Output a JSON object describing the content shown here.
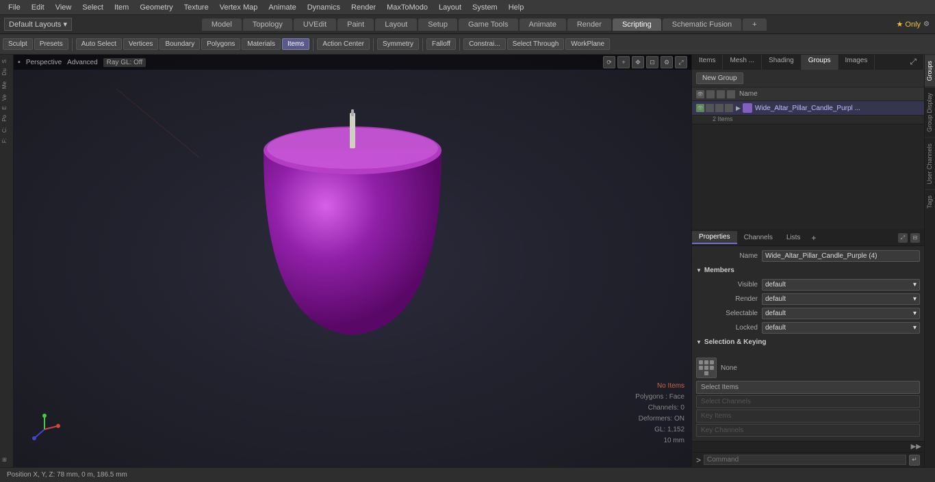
{
  "menu": {
    "items": [
      "File",
      "Edit",
      "View",
      "Select",
      "Item",
      "Geometry",
      "Texture",
      "Vertex Map",
      "Animate",
      "Dynamics",
      "Render",
      "MaxToModo",
      "Layout",
      "System",
      "Help"
    ]
  },
  "layout_bar": {
    "dropdown": "Default Layouts ▾",
    "tabs": [
      "Model",
      "Topology",
      "UVEdit",
      "Paint",
      "Layout",
      "Setup",
      "Game Tools",
      "Animate",
      "Render",
      "Scripting",
      "Schematic Fusion"
    ],
    "active_tab": "Scripting",
    "plus": "+",
    "star_label": "★ Only"
  },
  "toolbar": {
    "sculpt": "Sculpt",
    "presets": "Presets",
    "auto_select": "Auto Select",
    "vertices": "Vertices",
    "boundary": "Boundary",
    "polygons": "Polygons",
    "materials": "Materials",
    "items": "Items",
    "action_center": "Action Center",
    "symmetry": "Symmetry",
    "falloff": "Falloff",
    "constraints": "Constrai...",
    "select_through": "Select Through",
    "workplane": "WorkPlane"
  },
  "viewport": {
    "mode": "Perspective",
    "quality": "Advanced",
    "render": "Ray GL: Off",
    "status": {
      "no_items": "No Items",
      "polygons": "Polygons : Face",
      "channels": "Channels: 0",
      "deformers": "Deformers: ON",
      "gl": "GL: 1,152",
      "size": "10 mm"
    }
  },
  "status_bar": {
    "position": "Position X, Y, Z:   78 mm, 0 m, 186.5 mm"
  },
  "right_panel": {
    "tabs": [
      "Items",
      "Mesh ...",
      "Shading",
      "Groups",
      "Images"
    ],
    "active_tab": "Groups",
    "new_group_btn": "New Group",
    "list_header": "Name",
    "group_name": "Wide_Altar_Pillar_Candle_Purpl ...",
    "group_subtext": "2 Items",
    "properties": {
      "tabs": [
        "Properties",
        "Channels",
        "Lists"
      ],
      "active_tab": "Properties",
      "name_label": "Name",
      "name_value": "Wide_Altar_Pillar_Candle_Purple (4)",
      "members_section": "Members",
      "visible_label": "Visible",
      "visible_value": "default",
      "render_label": "Render",
      "render_value": "default",
      "selectable_label": "Selectable",
      "selectable_value": "default",
      "locked_label": "Locked",
      "locked_value": "default",
      "sel_keying_section": "Selection & Keying",
      "none_label": "None",
      "select_items_btn": "Select Items",
      "select_channels_btn": "Select Channels",
      "key_items_btn": "Key Items",
      "key_channels_btn": "Key Channels"
    }
  },
  "vert_tabs": [
    "Groups",
    "Group Display",
    "User Channels",
    "Tags"
  ],
  "command_bar": {
    "arrow": ">",
    "placeholder": "Command"
  }
}
